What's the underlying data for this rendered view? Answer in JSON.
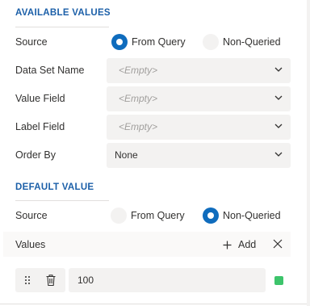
{
  "available_values": {
    "title": "AVAILABLE VALUES",
    "source_label": "Source",
    "source_options": [
      "From Query",
      "Non-Queried"
    ],
    "source_selected": "From Query",
    "data_set_name_label": "Data Set Name",
    "data_set_name_value": "<Empty>",
    "value_field_label": "Value Field",
    "value_field_value": "<Empty>",
    "label_field_label": "Label Field",
    "label_field_value": "<Empty>",
    "order_by_label": "Order By",
    "order_by_value": "None"
  },
  "default_value": {
    "title": "DEFAULT VALUE",
    "source_label": "Source",
    "source_options": [
      "From Query",
      "Non-Queried"
    ],
    "source_selected": "Non-Queried",
    "values_header": "Values",
    "add_label": "Add",
    "items": [
      {
        "value": "100"
      }
    ]
  },
  "colors": {
    "accent": "#0f6cbd",
    "section_title": "#1b5fa8",
    "field_bg": "#f3f2f1",
    "status_swatch": "#3dc46b"
  },
  "icons": [
    "chevron-down-icon",
    "plus-icon",
    "close-icon",
    "drag-handle-icon",
    "trash-icon"
  ]
}
